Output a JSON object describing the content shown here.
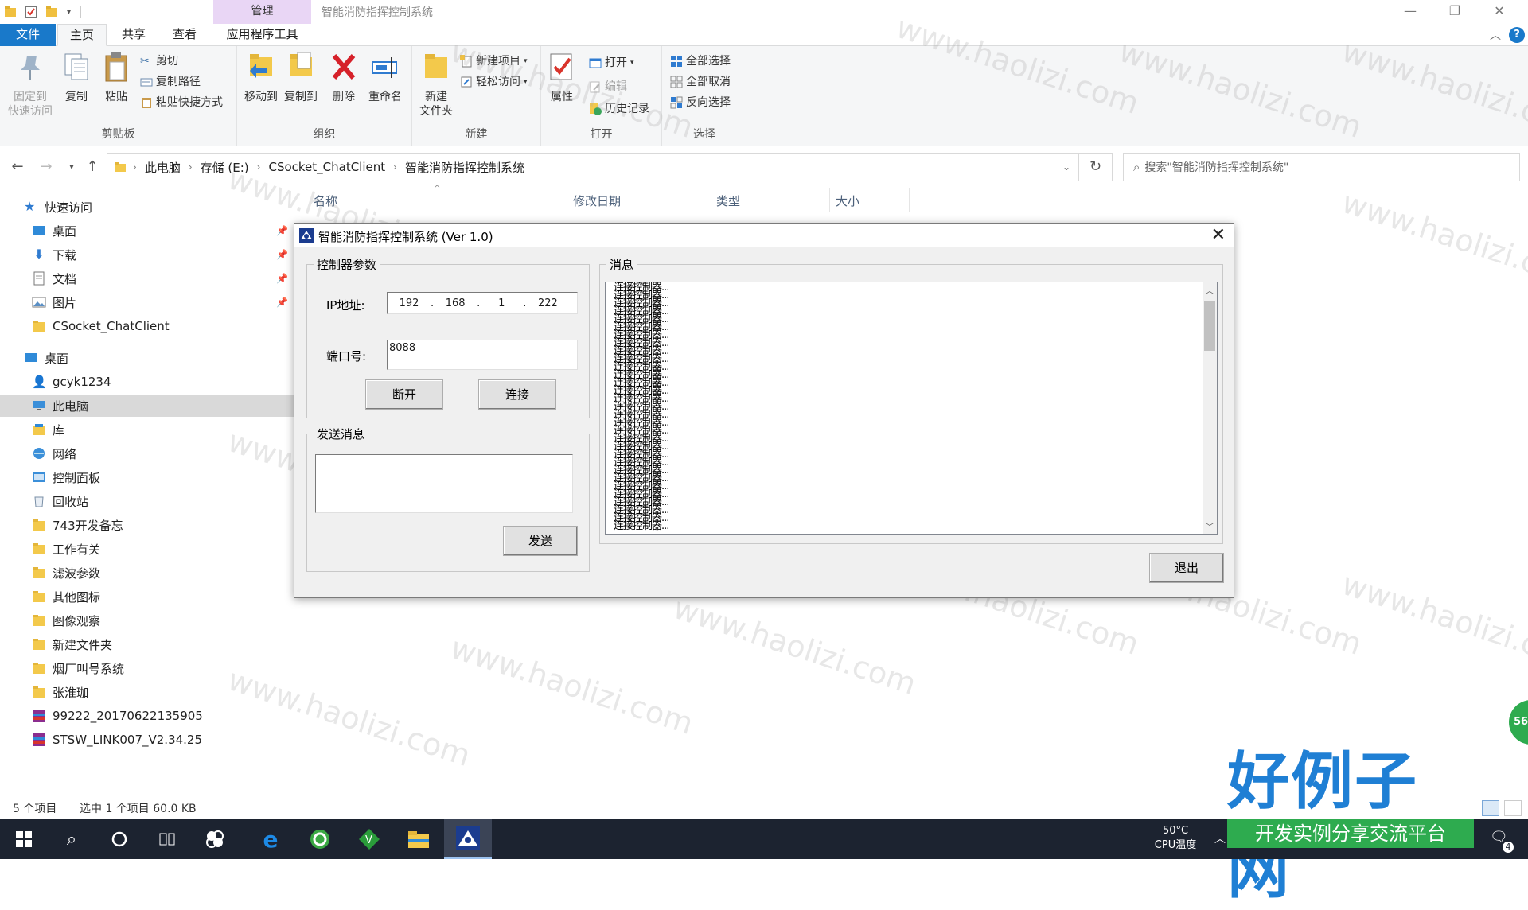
{
  "titlebar": {
    "context_tab": "管理",
    "title": "智能消防指挥控制系统"
  },
  "ribbon_tabs": {
    "file": "文件",
    "home": "主页",
    "share": "共享",
    "view": "查看",
    "app_tools": "应用程序工具"
  },
  "ribbon": {
    "clipboard": {
      "pin_line1": "固定到",
      "pin_line2": "快速访问",
      "copy": "复制",
      "paste": "粘贴",
      "cut": "剪切",
      "copy_path": "复制路径",
      "paste_shortcut": "粘贴快捷方式",
      "label": "剪贴板"
    },
    "organize": {
      "move_to": "移动到",
      "copy_to": "复制到",
      "delete": "删除",
      "rename": "重命名",
      "label": "组织"
    },
    "new": {
      "new_folder_line1": "新建",
      "new_folder_line2": "文件夹",
      "new_item": "新建项目",
      "easy_access": "轻松访问",
      "label": "新建"
    },
    "open": {
      "properties": "属性",
      "open": "打开",
      "edit": "编辑",
      "history": "历史记录",
      "label": "打开"
    },
    "select": {
      "select_all": "全部选择",
      "select_none": "全部取消",
      "invert": "反向选择",
      "label": "选择"
    }
  },
  "address": {
    "crumbs": [
      "此电脑",
      "存储 (E:)",
      "CSocket_ChatClient",
      "智能消防指挥控制系统"
    ],
    "search_placeholder": "搜索\"智能消防指挥控制系统\""
  },
  "columns": {
    "name": "名称",
    "modified": "修改日期",
    "type": "类型",
    "size": "大小"
  },
  "nav": {
    "quick_access": "快速访问",
    "qa_items": [
      "桌面",
      "下载",
      "文档",
      "图片",
      "CSocket_ChatClient"
    ],
    "desktop": "桌面",
    "items": [
      "gcyk1234",
      "此电脑",
      "库",
      "网络",
      "控制面板",
      "回收站",
      "743开发备忘",
      "工作有关",
      "滤波参数",
      "其他图标",
      "图像观察",
      "新建文件夹",
      "烟厂叫号系统",
      "张淮珈",
      "99222_20170622135905",
      "STSW_LINK007_V2.34.25"
    ]
  },
  "status": {
    "items": "5 个项目",
    "selected": "选中 1 个项目  60.0 KB"
  },
  "taskbar": {
    "cpu_temp": "50°C",
    "cpu_label": "CPU温度",
    "notif_count": "4",
    "badge": "56"
  },
  "dialog": {
    "title": "智能消防指挥控制系统 (Ver 1.0)",
    "controller_group": "控制器参数",
    "ip_label": "IP地址:",
    "ip": [
      "192",
      "168",
      "1",
      "222"
    ],
    "port_label": "端口号:",
    "port_value": "8088",
    "disconnect": "断开",
    "connect": "连接",
    "send_group": "发送消息",
    "send_value": "",
    "send": "发送",
    "msg_group": "消息",
    "msg_line": "连接控制器...",
    "exit": "退出"
  },
  "watermark": {
    "text": "www.haolizi.com",
    "brand": "好例子网",
    "brand_sub": "开发实例分享交流平台"
  }
}
